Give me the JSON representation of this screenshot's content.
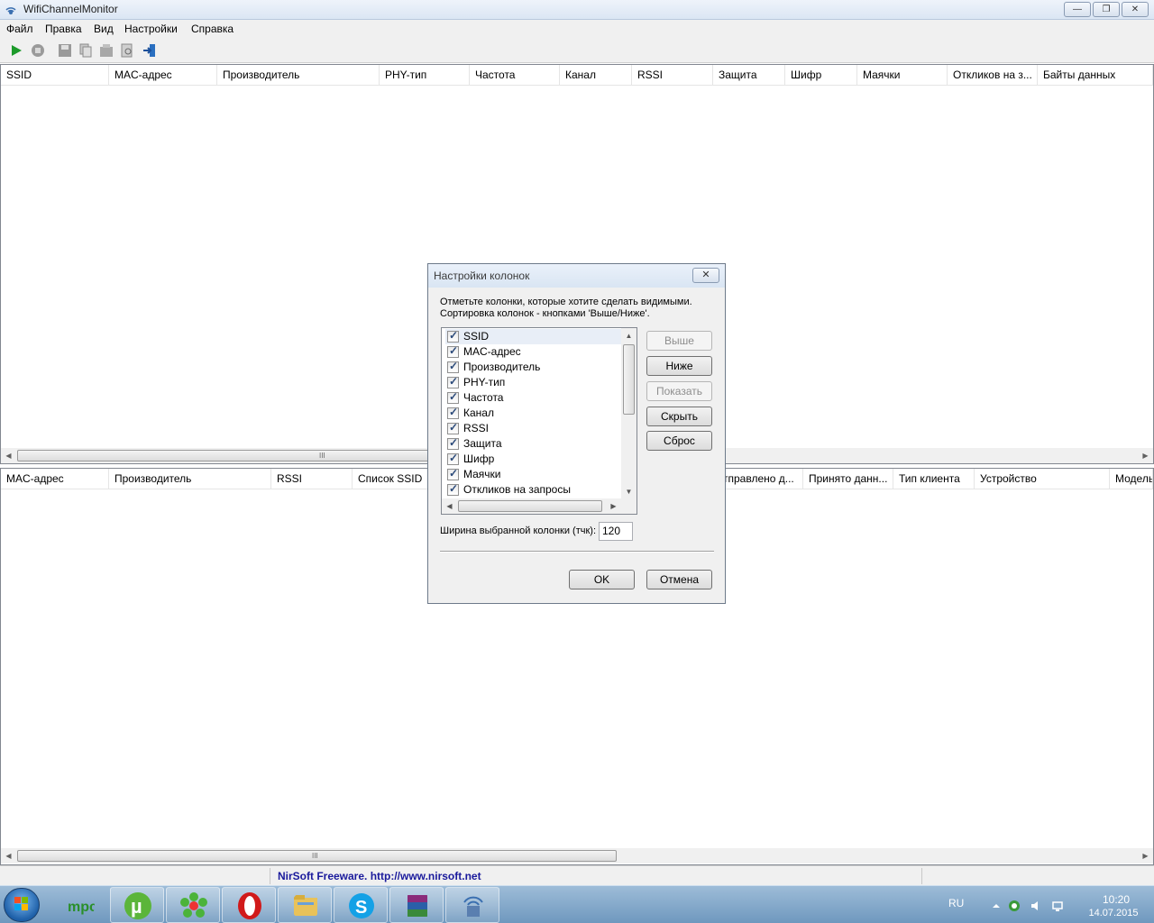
{
  "window": {
    "title": "WifiChannelMonitor",
    "buttons": {
      "minimize": "—",
      "restore": "❐",
      "close": "✕"
    }
  },
  "menu": [
    "Файл",
    "Правка",
    "Вид",
    "Настройки",
    "Справка"
  ],
  "toolbar": {
    "icons": [
      "play-icon",
      "stop-icon",
      "save-icon",
      "copy-icon",
      "properties-icon",
      "find-icon",
      "exit-icon"
    ],
    "accent": "#1c9a2a"
  },
  "top_list": {
    "columns": [
      "SSID",
      "MAC-адрес",
      "Производитель",
      "PHY-тип",
      "Частота",
      "Канал",
      "RSSI",
      "Защита",
      "Шифр",
      "Маячки",
      "Откликов на з...",
      "Байты данных"
    ]
  },
  "bottom_list": {
    "columns": [
      "MAC-адрес",
      "Производитель",
      "RSSI",
      "Список SSID",
      "тправлено д...",
      "Принято данн...",
      "Тип клиента",
      "Устройство",
      "Модель"
    ]
  },
  "status": {
    "link_text": "NirSoft Freeware.  http://www.nirsoft.net"
  },
  "dialog": {
    "title": "Настройки колонок",
    "instruction_line1": "Отметьте колонки, которые хотите сделать видимыми.",
    "instruction_line2": "Сортировка колонок - кнопками 'Выше/Ниже'.",
    "items": [
      "SSID",
      "MAC-адрес",
      "Производитель",
      "PHY-тип",
      "Частота",
      "Канал",
      "RSSI",
      "Защита",
      "Шифр",
      "Маячки",
      "Откликов на запросы"
    ],
    "buttons": {
      "up": "Выше",
      "down": "Ниже",
      "show": "Показать",
      "hide": "Скрыть",
      "reset": "Сброс",
      "ok": "OK",
      "cancel": "Отмена"
    },
    "width_label": "Ширина выбранной колонки (тчк):",
    "width_value": "120"
  },
  "taskbar": {
    "apps": [
      "mpc-icon",
      "utorrent-icon",
      "icq-icon",
      "opera-icon",
      "explorer-icon",
      "skype-icon",
      "winrar-icon",
      "wifi-monitor-icon"
    ],
    "lang": "RU",
    "time": "10:20",
    "date": "14.07.2015"
  }
}
